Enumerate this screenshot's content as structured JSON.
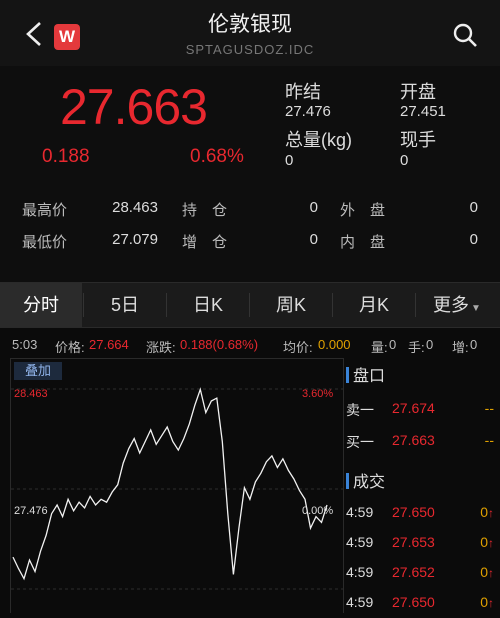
{
  "header": {
    "title": "伦敦银现",
    "code": "SPTAGUSDOZ.IDC",
    "logo": "W"
  },
  "quote": {
    "price": "27.663",
    "change": "0.188",
    "change_pct": "0.68%",
    "prev_close_label": "昨结",
    "prev_close": "27.476",
    "open_label": "开盘",
    "open": "27.451",
    "volume_label": "总量(kg)",
    "volume": "0",
    "current_label": "现手",
    "current": "0",
    "high_label": "最高价",
    "high": "28.463",
    "low_label": "最低价",
    "low": "27.079",
    "hold_label": "持　仓",
    "hold": "0",
    "add_label": "增　仓",
    "add": "0",
    "outer_label": "外　盘",
    "outer": "0",
    "inner_label": "内　盘",
    "inner": "0"
  },
  "tabs": [
    "分时",
    "5日",
    "日K",
    "周K",
    "月K",
    "更多"
  ],
  "info": {
    "time": "5:03",
    "price_label": "价格:",
    "price": "27.664",
    "change_label": "涨跌:",
    "change": "0.188(0.68%)",
    "avg_label": "均价:",
    "avg": "0.000",
    "vol_label": "量:",
    "vol": "0",
    "hand_label": "手:",
    "hand": "0",
    "inc_label": "增:",
    "inc": "0"
  },
  "chart": {
    "overlay": "叠加",
    "top_price": "28.463",
    "top_pct": "3.60%",
    "mid_price": "27.476",
    "mid_pct": "0.00%"
  },
  "chart_data": {
    "type": "line",
    "series": [
      {
        "values": [
          27.3,
          27.22,
          27.15,
          27.28,
          27.2,
          27.34,
          27.45,
          27.6,
          27.66,
          27.58,
          27.7,
          27.62,
          27.68,
          27.64,
          27.72,
          27.66,
          27.7,
          27.68,
          27.75,
          27.8,
          27.95,
          28.05,
          28.12,
          28.02,
          28.1,
          28.18,
          28.08,
          28.14,
          28.2,
          28.1,
          28.04,
          28.12,
          28.22,
          28.35,
          28.46,
          28.3,
          28.38,
          28.4,
          28.1,
          27.6,
          27.18,
          27.5,
          27.78,
          27.7,
          27.82,
          27.88,
          27.96,
          28.0,
          27.92,
          27.98,
          27.9,
          27.84,
          27.76,
          27.7,
          27.5,
          27.58,
          27.54,
          27.66
        ]
      }
    ],
    "ylim": [
      27.079,
      28.463
    ]
  },
  "orderbook": {
    "title": "盘口",
    "rows": [
      {
        "label": "卖一",
        "price": "27.674",
        "vol": "--"
      },
      {
        "label": "买一",
        "price": "27.663",
        "vol": "--"
      }
    ]
  },
  "trades": {
    "title": "成交",
    "rows": [
      {
        "time": "4:59",
        "price": "27.650",
        "vol": "0"
      },
      {
        "time": "4:59",
        "price": "27.653",
        "vol": "0"
      },
      {
        "time": "4:59",
        "price": "27.652",
        "vol": "0"
      },
      {
        "time": "4:59",
        "price": "27.650",
        "vol": "0"
      }
    ]
  },
  "colors": {
    "up": "#e8282f",
    "accent": "#e0a100",
    "link": "#3a84d8"
  }
}
